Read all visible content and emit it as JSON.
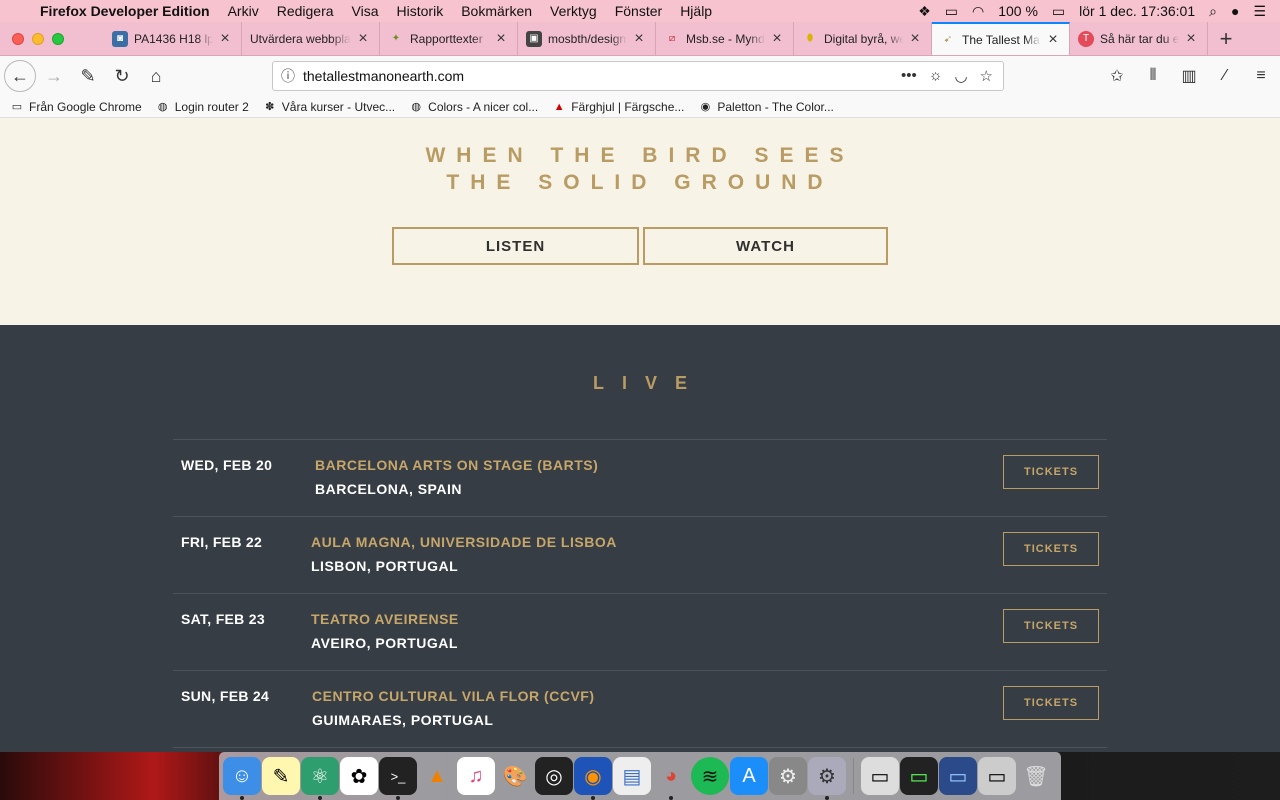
{
  "menubar": {
    "app_name": "Firefox Developer Edition",
    "items": [
      "Arkiv",
      "Redigera",
      "Visa",
      "Historik",
      "Bokmärken",
      "Verktyg",
      "Fönster",
      "Hjälp"
    ],
    "battery": "100 %",
    "clock": "lör 1 dec.  17:36:01"
  },
  "tabs": [
    {
      "label": "PA1436 H18 lp",
      "active": false
    },
    {
      "label": "Utvärdera webbpla",
      "active": false
    },
    {
      "label": "Rapporttexter",
      "active": false
    },
    {
      "label": "mosbth/design",
      "active": false
    },
    {
      "label": "Msb.se - Myndi",
      "active": false
    },
    {
      "label": "Digital byrå, we",
      "active": false
    },
    {
      "label": "The Tallest Ma",
      "active": true
    },
    {
      "label": "Så här tar du e",
      "active": false
    }
  ],
  "navbar": {
    "url": "thetallestmanonearth.com"
  },
  "bookmarks": [
    {
      "label": "Från Google Chrome",
      "icon": "folder-icon"
    },
    {
      "label": "Login router 2",
      "icon": "globe-icon"
    },
    {
      "label": "Våra kurser - Utvec...",
      "icon": "tree-icon"
    },
    {
      "label": "Colors - A nicer col...",
      "icon": "globe-icon"
    },
    {
      "label": "Färghjul | Färgsche...",
      "icon": "adobe-icon"
    },
    {
      "label": "Paletton - The Color...",
      "icon": "palette-icon"
    }
  ],
  "hero": {
    "album_line1": "WHEN THE BIRD SEES",
    "album_line2": "THE SOLID GROUND",
    "listen_label": "LISTEN",
    "watch_label": "WATCH"
  },
  "live": {
    "title": "LIVE",
    "tickets_label": "TICKETS",
    "shows": [
      {
        "date": "WED, FEB 20",
        "venue": "BARCELONA ARTS ON STAGE (BARTS)",
        "city": "BARCELONA, SPAIN"
      },
      {
        "date": "FRI, FEB 22",
        "venue": "AULA MAGNA, UNIVERSIDADE DE LISBOA",
        "city": "LISBON, PORTUGAL"
      },
      {
        "date": "SAT, FEB 23",
        "venue": "TEATRO AVEIRENSE",
        "city": "AVEIRO, PORTUGAL"
      },
      {
        "date": "SUN, FEB 24",
        "venue": "CENTRO CULTURAL VILA FLOR (CCVF)",
        "city": "GUIMARAES, PORTUGAL"
      }
    ]
  },
  "colors": {
    "gold": "#b99b64",
    "hero_bg": "#f7f3e6",
    "live_bg": "#363d45",
    "menubar_bg": "#f6c3cf"
  }
}
